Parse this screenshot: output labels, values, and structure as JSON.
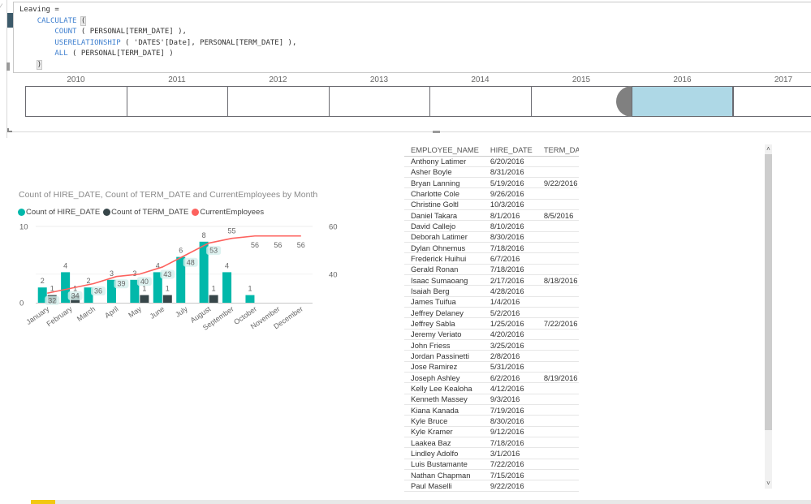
{
  "formula": {
    "lines": [
      {
        "indent": "",
        "parts": [
          {
            "t": "Leaving =",
            "kw": false
          }
        ]
      },
      {
        "indent": "    ",
        "parts": [
          {
            "t": "CALCULATE",
            "kw": true
          },
          {
            "t": " ",
            "kw": false
          },
          {
            "t": "(",
            "kw": false,
            "hl": true
          }
        ]
      },
      {
        "indent": "        ",
        "parts": [
          {
            "t": "COUNT",
            "kw": true
          },
          {
            "t": " ( PERSONAL[TERM_DATE] ),",
            "kw": false
          }
        ]
      },
      {
        "indent": "        ",
        "parts": [
          {
            "t": "USERELATIONSHIP",
            "kw": true
          },
          {
            "t": " ( 'DATES'[Date], PERSONAL[TERM_DATE] ),",
            "kw": false
          }
        ]
      },
      {
        "indent": "        ",
        "parts": [
          {
            "t": "ALL",
            "kw": true
          },
          {
            "t": " ( PERSONAL[TERM_DATE] )",
            "kw": false
          }
        ]
      },
      {
        "indent": "    ",
        "parts": [
          {
            "t": ")",
            "kw": false,
            "hl": true
          }
        ]
      }
    ]
  },
  "timeline": {
    "years": [
      "2010",
      "2011",
      "2012",
      "2013",
      "2014",
      "2015",
      "2016",
      "2017"
    ],
    "selected": "2016",
    "selected_color": "#aed8e6"
  },
  "chart_data": {
    "type": "bar",
    "title": "Count of HIRE_DATE, Count of TERM_DATE and CurrentEmployees by Month",
    "xlabel": "",
    "ylabel": "",
    "categories": [
      "January",
      "February",
      "March",
      "April",
      "May",
      "June",
      "July",
      "August",
      "September",
      "October",
      "November",
      "December"
    ],
    "series": [
      {
        "name": "Count of HIRE_DATE",
        "type": "bar",
        "axis": "left",
        "color": "#01b8aa",
        "values": [
          2,
          4,
          2,
          3,
          3,
          4,
          6,
          8,
          4,
          1,
          null,
          null
        ]
      },
      {
        "name": "Count of TERM_DATE",
        "type": "bar",
        "axis": "left",
        "color": "#374649",
        "values": [
          1,
          1,
          null,
          null,
          1,
          1,
          null,
          1,
          null,
          null,
          null,
          null
        ]
      },
      {
        "name": "CurrentEmployees",
        "type": "line",
        "axis": "right",
        "color": "#fd625e",
        "values": [
          32,
          34,
          36,
          39,
          40,
          43,
          48,
          53,
          55,
          56,
          56,
          56
        ]
      }
    ],
    "y_left": {
      "ticks": [
        "0",
        "10"
      ],
      "range": [
        0,
        10
      ]
    },
    "y_right": {
      "ticks": [
        "40",
        "60"
      ],
      "range": [
        28,
        60
      ]
    },
    "legend_position": "top-left",
    "grid": true
  },
  "table": {
    "columns": [
      "EMPLOYEE_NAME",
      "HIRE_DATE",
      "TERM_DATE"
    ],
    "rows": [
      [
        "Anthony Latimer",
        "6/20/2016",
        ""
      ],
      [
        "Asher Boyle",
        "8/31/2016",
        ""
      ],
      [
        "Bryan Lanning",
        "5/19/2016",
        "9/22/2016"
      ],
      [
        "Charlotte Cole",
        "9/26/2016",
        ""
      ],
      [
        "Christine Goltl",
        "10/3/2016",
        ""
      ],
      [
        "Daniel Takara",
        "8/1/2016",
        "8/5/2016"
      ],
      [
        "David Callejo",
        "8/10/2016",
        ""
      ],
      [
        "Deborah Latimer",
        "8/30/2016",
        ""
      ],
      [
        "Dylan Ohnemus",
        "7/18/2016",
        ""
      ],
      [
        "Frederick Huihui",
        "6/7/2016",
        ""
      ],
      [
        "Gerald Ronan",
        "7/18/2016",
        ""
      ],
      [
        "Isaac Sumaoang",
        "2/17/2016",
        "8/18/2016"
      ],
      [
        "Isaiah Berg",
        "4/28/2016",
        ""
      ],
      [
        "James Tuifua",
        "1/4/2016",
        ""
      ],
      [
        "Jeffrey Delaney",
        "5/2/2016",
        ""
      ],
      [
        "Jeffrey Sabla",
        "1/25/2016",
        "7/22/2016"
      ],
      [
        "Jeremy Veriato",
        "4/20/2016",
        ""
      ],
      [
        "John Friess",
        "3/25/2016",
        ""
      ],
      [
        "Jordan Passinetti",
        "2/8/2016",
        ""
      ],
      [
        "Jose Ramirez",
        "5/31/2016",
        ""
      ],
      [
        "Joseph Ashley",
        "6/2/2016",
        "8/19/2016"
      ],
      [
        "Kelly Lee Kealoha",
        "4/12/2016",
        ""
      ],
      [
        "Kenneth Massey",
        "9/3/2016",
        ""
      ],
      [
        "Kiana Kanada",
        "7/19/2016",
        ""
      ],
      [
        "Kyle Bruce",
        "8/30/2016",
        ""
      ],
      [
        "Kyle Kramer",
        "9/12/2016",
        ""
      ],
      [
        "Laakea Baz",
        "7/18/2016",
        ""
      ],
      [
        "Lindley Adolfo",
        "3/1/2016",
        ""
      ],
      [
        "Luis Bustamante",
        "7/22/2016",
        ""
      ],
      [
        "Nathan Chapman",
        "7/15/2016",
        ""
      ],
      [
        "Paul Maselli",
        "9/22/2016",
        ""
      ]
    ]
  },
  "scrollbar": {
    "up_icon": "˄",
    "down_icon": "˅"
  },
  "icons": {
    "edit": "⁄"
  },
  "page_tab": {
    "active_color": "#f2c811"
  }
}
